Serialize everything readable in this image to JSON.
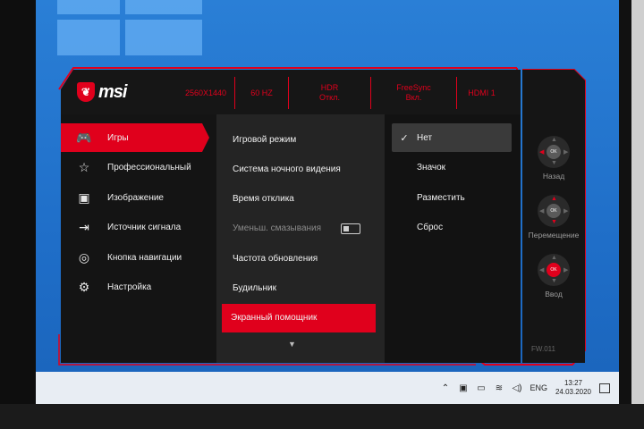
{
  "header": {
    "logo_text": "msi",
    "status": [
      {
        "line1": "2560X1440",
        "line2": ""
      },
      {
        "line1": "60 HZ",
        "line2": ""
      },
      {
        "line1": "HDR",
        "line2": "Откл."
      },
      {
        "line1": "FreeSync",
        "line2": "Вкл."
      },
      {
        "line1": "HDMI 1",
        "line2": ""
      }
    ]
  },
  "main_menu": [
    {
      "label": "Игры",
      "icon": "gamepad-icon",
      "glyph": "🎮",
      "active": true
    },
    {
      "label": "Профессиональный",
      "icon": "star-icon",
      "glyph": "☆",
      "active": false
    },
    {
      "label": "Изображение",
      "icon": "image-icon",
      "glyph": "▣",
      "active": false
    },
    {
      "label": "Источник сигнала",
      "icon": "input-source-icon",
      "glyph": "⇥",
      "active": false
    },
    {
      "label": "Кнопка навигации",
      "icon": "navigation-key-icon",
      "glyph": "◎",
      "active": false
    },
    {
      "label": "Настройка",
      "icon": "settings-gear-icon",
      "glyph": "⚙",
      "active": false
    }
  ],
  "sub_menu": [
    {
      "label": "Игровой режим",
      "state": "normal"
    },
    {
      "label": "Система ночного видения",
      "state": "normal"
    },
    {
      "label": "Время отклика",
      "state": "normal"
    },
    {
      "label": "Уменьш. смазывания",
      "state": "disabled"
    },
    {
      "label": "Частота обновления",
      "state": "normal"
    },
    {
      "label": "Будильник",
      "state": "normal"
    },
    {
      "label": "Экранный помощник",
      "state": "selected"
    }
  ],
  "options": [
    {
      "label": "Нет",
      "selected": true
    },
    {
      "label": "Значок",
      "selected": false
    },
    {
      "label": "Разместить",
      "selected": false
    },
    {
      "label": "Сброс",
      "selected": false
    }
  ],
  "nav_hints": [
    {
      "label": "Назад",
      "ok": "OK"
    },
    {
      "label": "Перемещение",
      "ok": "OK"
    },
    {
      "label": "Ввод",
      "ok": "OK"
    }
  ],
  "firmware": "FW.011",
  "taskbar": {
    "lang": "ENG",
    "time": "13:27",
    "date": "24.03.2020"
  },
  "colors": {
    "accent": "#e0001c",
    "desktop": "#2a7fd6"
  }
}
